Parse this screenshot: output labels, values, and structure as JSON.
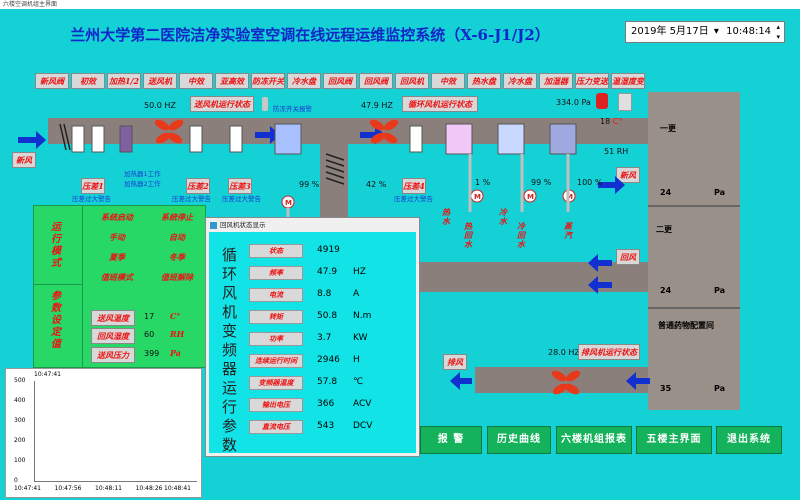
{
  "window": {
    "title": "六楼空调机组主界面"
  },
  "title": "兰州大学第二医院洁净实验室空调在线远程运维监控系统（X-6-J1/J2）",
  "datetime": {
    "date": "2019年 5月17日",
    "time": "10:48:14"
  },
  "top_labels": [
    "新风阀",
    "初效",
    "加热1/2",
    "送风机",
    "中效",
    "亚高效",
    "防冻开关",
    "冷水盘",
    "回风阀",
    "回风阀",
    "回风机",
    "中效",
    "热水盘",
    "冷水盘",
    "加湿器",
    "压力变送器",
    "温湿度变送器"
  ],
  "supply_fan": {
    "freq": "50.0",
    "unit": "HZ",
    "status_label": "送风机运行状态"
  },
  "antifreeze_label": "防冻开关报警",
  "return_fan": {
    "freq": "47.9",
    "unit": "HZ",
    "status_label": "循环风机运行状态"
  },
  "pressure_reading": {
    "value": "334.0",
    "unit": "Pa"
  },
  "temp_reading": {
    "value": "18",
    "unit": "C°"
  },
  "rh_reading": {
    "value": "51",
    "unit": "RH"
  },
  "fresh_air_label": "新风",
  "fresh_air_label2": "新风",
  "return_air_label": "回风",
  "exhaust_air_label": "排风",
  "filters": {
    "p1": "压差1",
    "p2": "压差2",
    "p3": "压差3",
    "p4": "压差4",
    "alarm1": "压差过大警告",
    "heater1": "加热器1工作",
    "heater2": "加热器2工作",
    "alarm2": "压差过大警告",
    "alarm3": "压差过大警告",
    "alarm4": "压差过大警告"
  },
  "valves": {
    "v1": "99",
    "v2": "42",
    "v3": "1",
    "v4": "99",
    "v5": "100",
    "unit": "%",
    "labels": [
      "热水",
      "热回水",
      "冷水",
      "冷回水",
      "蒸汽"
    ]
  },
  "rooms": [
    {
      "name": "一更",
      "pressure": "24",
      "unit": "Pa"
    },
    {
      "name": "二更",
      "pressure": "24",
      "unit": "Pa"
    },
    {
      "name": "普通药物配置间",
      "pressure": "35",
      "unit": "Pa"
    }
  ],
  "exhaust_fan": {
    "freq": "28.0",
    "unit": "HZ",
    "status_label": "排风机运行状态"
  },
  "control_panel": {
    "section1": "运行模式",
    "section2": "参数设定值",
    "buttons": [
      "系统启动",
      "系统停止",
      "手动",
      "自动",
      "夏季",
      "冬季",
      "值班模式",
      "值班解除"
    ],
    "params": [
      {
        "label": "送风温度",
        "value": "17",
        "unit": "C°"
      },
      {
        "label": "回风湿度",
        "value": "60",
        "unit": "RH"
      },
      {
        "label": "送风压力",
        "value": "399",
        "unit": "Pa"
      }
    ]
  },
  "trend_chart": {
    "header_time": "10:47:41",
    "y_ticks": [
      "500",
      "400",
      "300",
      "200",
      "100",
      "0"
    ],
    "x_ticks": [
      "10:47:41",
      "10:47:56",
      "10:48:11",
      "10:48:26",
      "10:48:41"
    ]
  },
  "popup": {
    "title": "回风机状态显示",
    "vertical_title": "循环风机变频器运行参数",
    "rows": [
      {
        "label": "状态",
        "value": "4919",
        "unit": ""
      },
      {
        "label": "频率",
        "value": "47.9",
        "unit": "HZ"
      },
      {
        "label": "电流",
        "value": "8.8",
        "unit": "A"
      },
      {
        "label": "转矩",
        "value": "50.8",
        "unit": "N.m"
      },
      {
        "label": "功率",
        "value": "3.7",
        "unit": "KW"
      },
      {
        "label": "连续运行时间",
        "value": "2946",
        "unit": "H"
      },
      {
        "label": "变频器温度",
        "value": "57.8",
        "unit": "℃"
      },
      {
        "label": "输出电压",
        "value": "366",
        "unit": "ACV"
      },
      {
        "label": "直流电压",
        "value": "543",
        "unit": "DCV"
      }
    ]
  },
  "bottom_buttons": [
    "报  警",
    "历史曲线",
    "六楼机组报表",
    "五楼主界面",
    "退出系统"
  ],
  "colors": {
    "bg": "#14d1d6",
    "duct": "#8a7f7a",
    "green_btn": "#13b25b",
    "red_text": "#ee1111",
    "blue_title": "#1027c8"
  }
}
